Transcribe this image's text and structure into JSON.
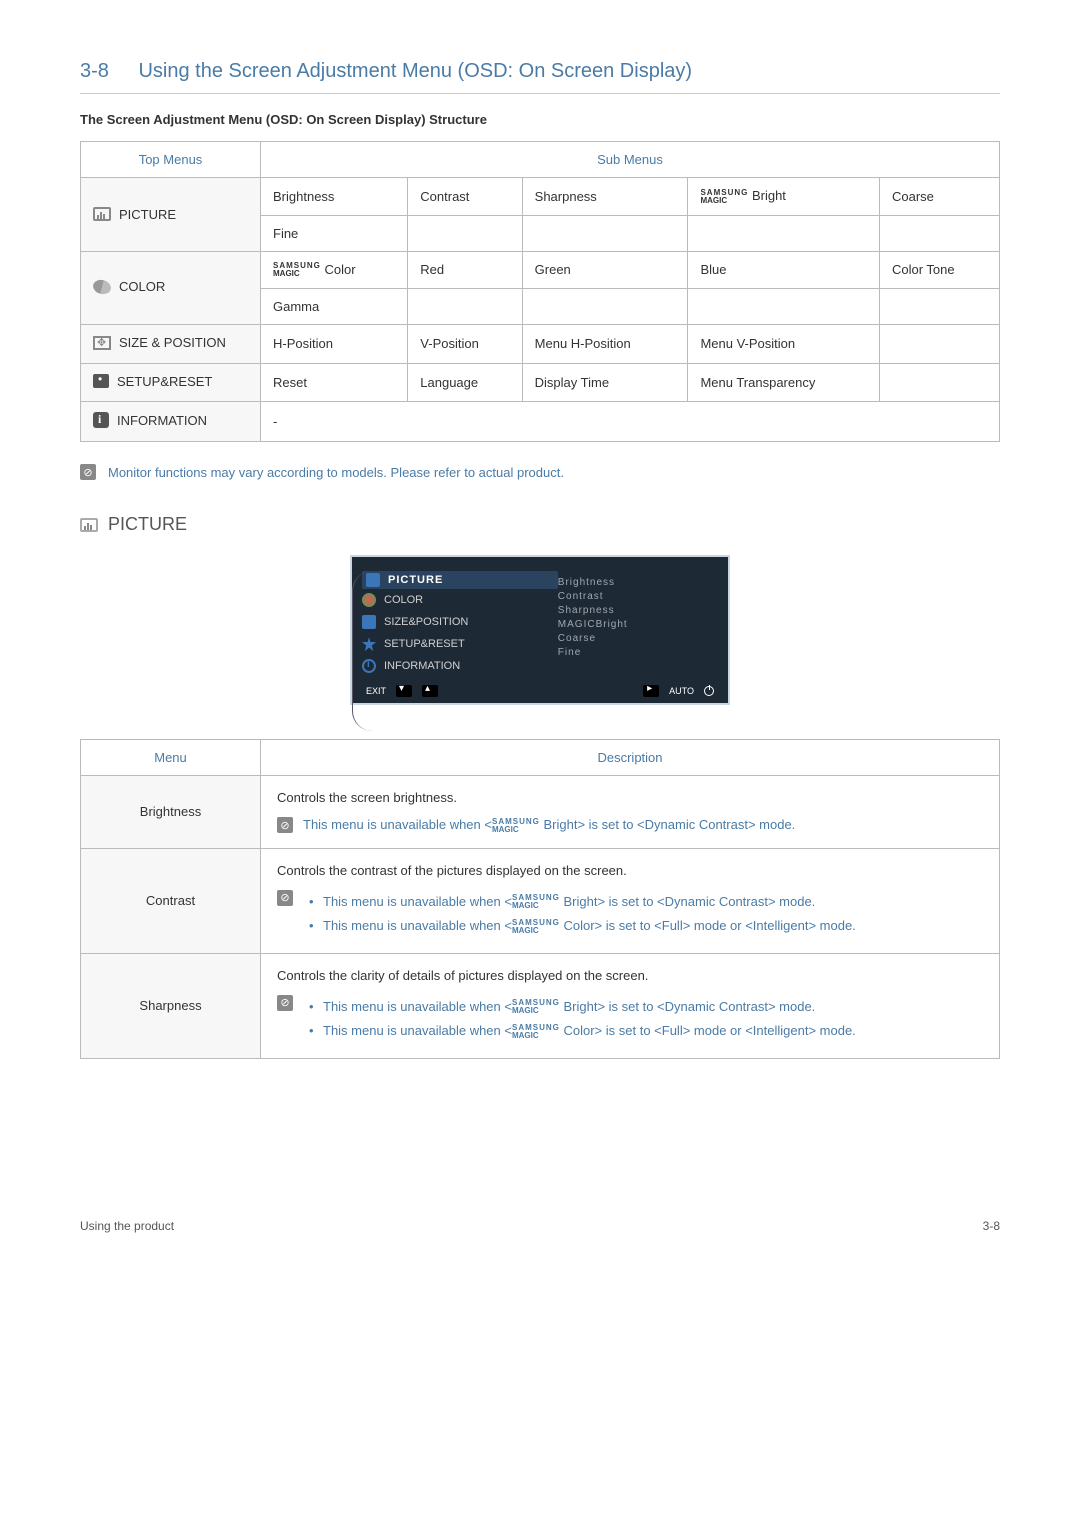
{
  "title": {
    "num": "3-8",
    "text": "Using the Screen Adjustment Menu (OSD: On Screen Display)"
  },
  "subheading": "The Screen Adjustment Menu (OSD: On Screen Display) Structure",
  "structure": {
    "head_top": "Top Menus",
    "head_sub": "Sub Menus",
    "rows": [
      {
        "menu": "PICTURE",
        "cells": [
          "Brightness",
          "Contrast",
          "Sharpness",
          "MAGIC Bright",
          "Coarse"
        ],
        "cells2": [
          "Fine",
          "",
          "",
          "",
          ""
        ]
      },
      {
        "menu": "COLOR",
        "cells": [
          "MAGIC Color",
          "Red",
          "Green",
          "Blue",
          "Color Tone"
        ],
        "cells2": [
          "Gamma",
          "",
          "",
          "",
          ""
        ]
      },
      {
        "menu": "SIZE & POSITION",
        "cells": [
          "H-Position",
          "V-Position",
          "Menu H-Position",
          "Menu V-Position",
          ""
        ]
      },
      {
        "menu": "SETUP&RESET",
        "cells": [
          "Reset",
          "Language",
          "Display Time",
          "Menu Transparency",
          ""
        ]
      },
      {
        "menu": "INFORMATION",
        "cells": [
          "-",
          "",
          "",
          "",
          ""
        ]
      }
    ]
  },
  "magic_label": {
    "top": "SAMSUNG",
    "bot": "MAGIC"
  },
  "note1": "Monitor functions may vary according to models. Please refer to actual product.",
  "picture_heading": "PICTURE",
  "osd": {
    "left": [
      "PICTURE",
      "COLOR",
      "SIZE&POSITION",
      "SETUP&RESET",
      "INFORMATION"
    ],
    "right": [
      "Brightness",
      "Contrast",
      "Sharpness",
      "MAGICBright",
      "Coarse",
      "Fine"
    ],
    "footer_exit": "EXIT",
    "footer_auto": "AUTO"
  },
  "desc_head_menu": "Menu",
  "desc_head_desc": "Description",
  "desc": {
    "brightness": {
      "name": "Brightness",
      "line": "Controls the screen brightness.",
      "note": "This menu is unavailable when <MAGIC Bright> is set to <Dynamic Contrast> mode."
    },
    "contrast": {
      "name": "Contrast",
      "line": "Controls the contrast of the pictures displayed on the screen.",
      "b1": "This menu is unavailable when <MAGIC Bright> is set to <Dynamic Contrast> mode.",
      "b2": "This menu is unavailable when <MAGIC Color> is set to <Full> mode or <Intelligent> mode."
    },
    "sharpness": {
      "name": "Sharpness",
      "line": "Controls the clarity of details of pictures displayed on the screen.",
      "b1": "This menu is unavailable when <MAGIC Bright> is set to <Dynamic Contrast> mode.",
      "b2": "This menu is unavailable when <MAGIC Color> is set to <Full> mode or <Intelligent> mode."
    }
  },
  "footer": {
    "left": "Using the product",
    "right": "3-8"
  }
}
